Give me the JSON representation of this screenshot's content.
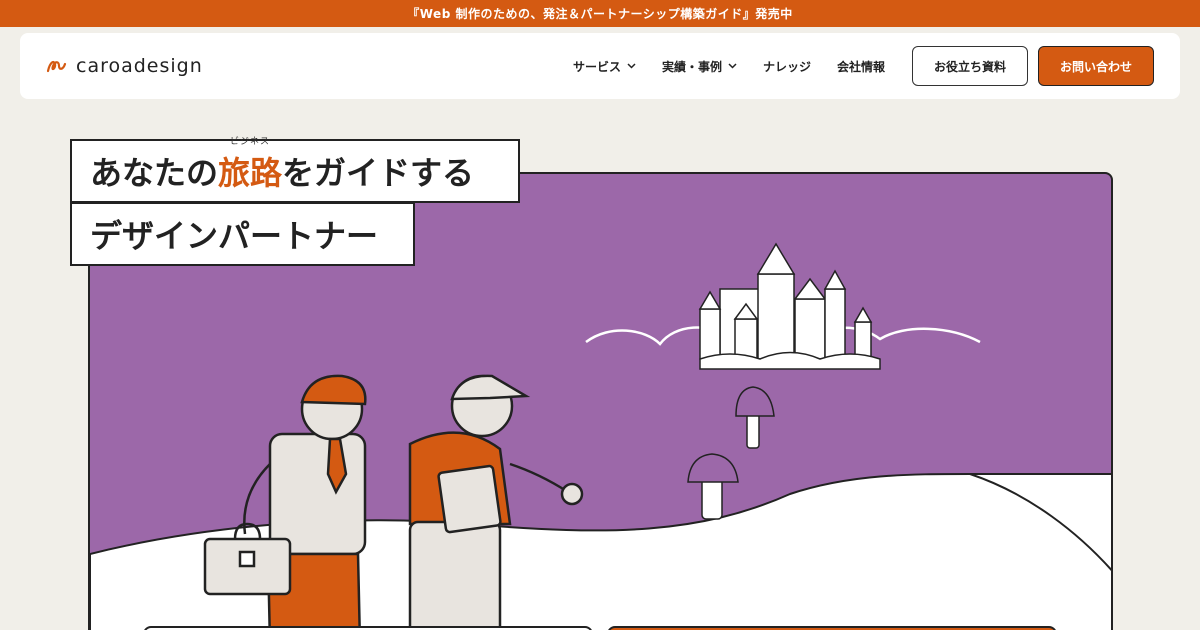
{
  "announcement": {
    "text": "『Web 制作のための、発注＆パートナーシップ構築ガイド』発売中"
  },
  "header": {
    "logo_text": "caroadesign",
    "nav": [
      {
        "label": "サービス",
        "has_dropdown": true
      },
      {
        "label": "実績・事例",
        "has_dropdown": true
      },
      {
        "label": "ナレッジ",
        "has_dropdown": false
      },
      {
        "label": "会社情報",
        "has_dropdown": false
      }
    ],
    "cta_secondary": "お役立ち資料",
    "cta_primary": "お問い合わせ"
  },
  "hero": {
    "line1_before": "あなたの",
    "line1_accent": "旅路",
    "line1_ruby": "ビジネス",
    "line1_after": "をガイドする",
    "line2": "デザインパートナー"
  },
  "colors": {
    "brand_orange": "#d45a12",
    "hero_purple": "#9c68a9",
    "background": "#f1efe9"
  }
}
